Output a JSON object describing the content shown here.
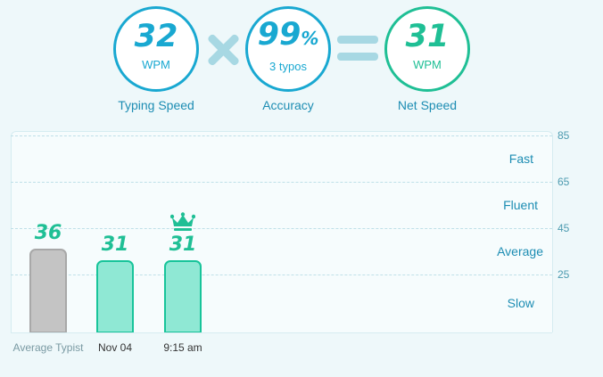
{
  "stats": {
    "typing": {
      "value": "32",
      "unit": "WPM",
      "caption": "Typing Speed"
    },
    "accuracy": {
      "value": "99",
      "percent": "%",
      "sub": "3 typos",
      "caption": "Accuracy"
    },
    "net": {
      "value": "31",
      "unit": "WPM",
      "caption": "Net Speed"
    }
  },
  "icons": {
    "operator1": "times-icon",
    "operator2": "equals-icon",
    "best": "crown-icon"
  },
  "colors": {
    "blue": "#19a8d1",
    "green": "#1fbf95",
    "bar_gray": "#c4c4c4",
    "bar_teal": "#8fe8d4"
  },
  "chart_data": {
    "type": "bar",
    "ylim": [
      0,
      85
    ],
    "yticks": [
      "85",
      "65",
      "45",
      "25"
    ],
    "zones": [
      "Fast",
      "Fluent",
      "Average",
      "Slow"
    ],
    "categories": [
      "Average Typist",
      "Nov 04",
      "9:15 am"
    ],
    "values": [
      36,
      31,
      31
    ],
    "labels": [
      "36",
      "31",
      "31"
    ]
  }
}
